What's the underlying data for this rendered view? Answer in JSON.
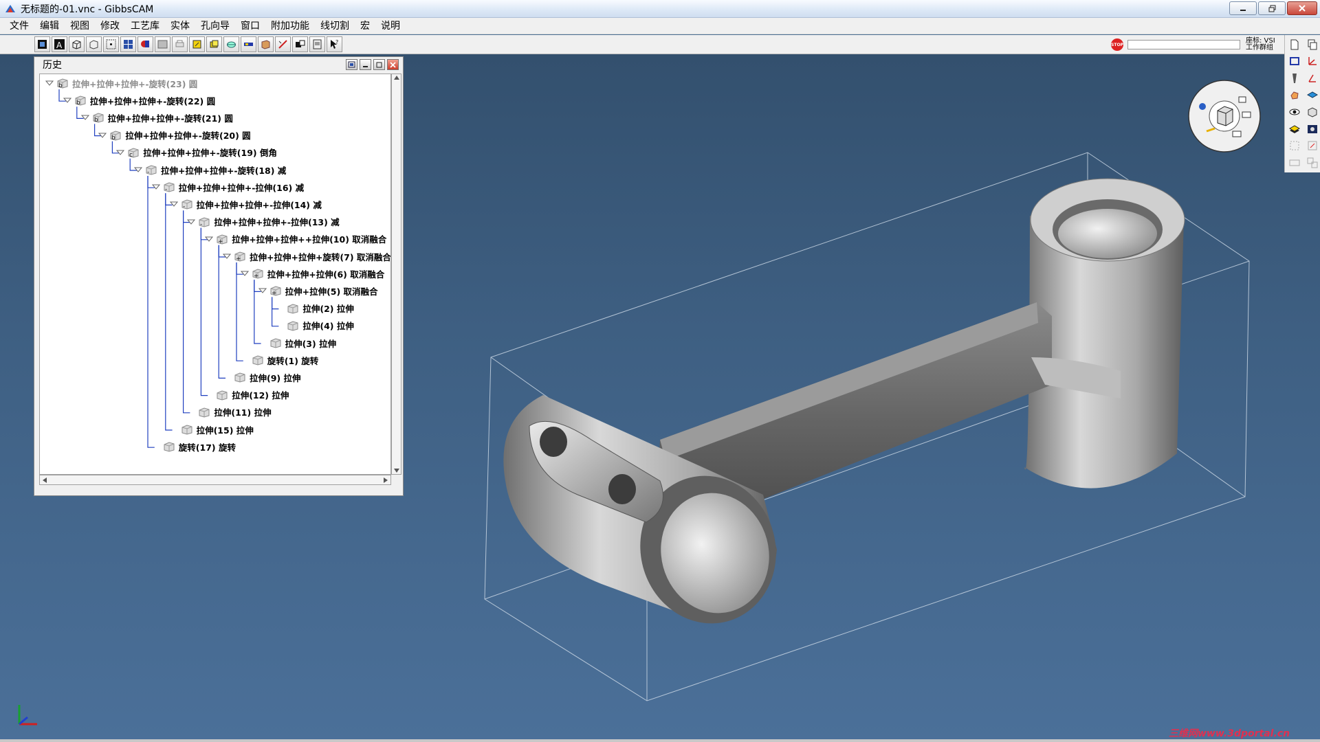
{
  "window": {
    "title": "无标题的-01.vnc - GibbsCAM",
    "controls": [
      "minimize",
      "restore",
      "close"
    ]
  },
  "menu": [
    "文件",
    "编辑",
    "视图",
    "修改",
    "工艺库",
    "实体",
    "孔向导",
    "窗口",
    "附加功能",
    "线切割",
    "宏",
    "说明"
  ],
  "toolbar": {
    "coord_label": "座标: VSI",
    "coord_sub": "工作群组",
    "stop_label": "STOP"
  },
  "history": {
    "title": "历史",
    "nodes": [
      {
        "label": "拉伸+拉伸+拉伸+-旋转(23) 圆",
        "depth": 0,
        "icon": "b",
        "dim": true,
        "expander": true
      },
      {
        "label": "拉伸+拉伸+拉伸+-旋转(22) 圆",
        "depth": 1,
        "icon": "b",
        "dim": false,
        "expander": true
      },
      {
        "label": "拉伸+拉伸+拉伸+-旋转(21) 圆",
        "depth": 2,
        "icon": "b",
        "dim": false,
        "expander": true
      },
      {
        "label": "拉伸+拉伸+拉伸+-旋转(20) 圆",
        "depth": 3,
        "icon": "b",
        "dim": false,
        "expander": true
      },
      {
        "label": "拉伸+拉伸+拉伸+-旋转(19) 倒角",
        "depth": 4,
        "icon": "c",
        "dim": false,
        "expander": true
      },
      {
        "label": "拉伸+拉伸+拉伸+-旋转(18) 减",
        "depth": 5,
        "icon": "-",
        "dim": false,
        "expander": true
      },
      {
        "label": "拉伸+拉伸+拉伸+-拉伸(16) 减",
        "depth": 6,
        "icon": "-",
        "dim": false,
        "expander": true
      },
      {
        "label": "拉伸+拉伸+拉伸+-拉伸(14) 减",
        "depth": 7,
        "icon": "-",
        "dim": false,
        "expander": true
      },
      {
        "label": "拉伸+拉伸+拉伸+-拉伸(13) 减",
        "depth": 8,
        "icon": "-",
        "dim": false,
        "expander": true
      },
      {
        "label": "拉伸+拉伸+拉伸++拉伸(10) 取消融合",
        "depth": 9,
        "icon": "+",
        "dim": false,
        "expander": true
      },
      {
        "label": "拉伸+拉伸+拉伸+旋转(7) 取消融合",
        "depth": 10,
        "icon": "+",
        "dim": false,
        "expander": true
      },
      {
        "label": "拉伸+拉伸+拉伸(6) 取消融合",
        "depth": 11,
        "icon": "+",
        "dim": false,
        "expander": true
      },
      {
        "label": "拉伸+拉伸(5) 取消融合",
        "depth": 12,
        "icon": "+",
        "dim": false,
        "expander": true
      },
      {
        "label": "拉伸(2) 拉伸",
        "depth": 13,
        "icon": "",
        "dim": false,
        "expander": false
      },
      {
        "label": "拉伸(4) 拉伸",
        "depth": 13,
        "icon": "",
        "dim": false,
        "expander": false
      },
      {
        "label": "拉伸(3) 拉伸",
        "depth": 12,
        "icon": "",
        "dim": false,
        "expander": false
      },
      {
        "label": "旋转(1) 旋转",
        "depth": 11,
        "icon": "",
        "dim": false,
        "expander": false
      },
      {
        "label": "拉伸(9) 拉伸",
        "depth": 10,
        "icon": "",
        "dim": false,
        "expander": false
      },
      {
        "label": "拉伸(12) 拉伸",
        "depth": 9,
        "icon": "",
        "dim": false,
        "expander": false
      },
      {
        "label": "拉伸(11) 拉伸",
        "depth": 8,
        "icon": "",
        "dim": false,
        "expander": false
      },
      {
        "label": "拉伸(15) 拉伸",
        "depth": 7,
        "icon": "",
        "dim": false,
        "expander": false
      },
      {
        "label": "旋转(17) 旋转",
        "depth": 6,
        "icon": "",
        "dim": false,
        "expander": false
      }
    ]
  },
  "viewport": {
    "watermark": "三维网www.3dportal.cn"
  },
  "colors": {
    "tree_line": "#1f3fbf",
    "viewport_bg": "#3e5f82",
    "watermark": "#e03050"
  }
}
